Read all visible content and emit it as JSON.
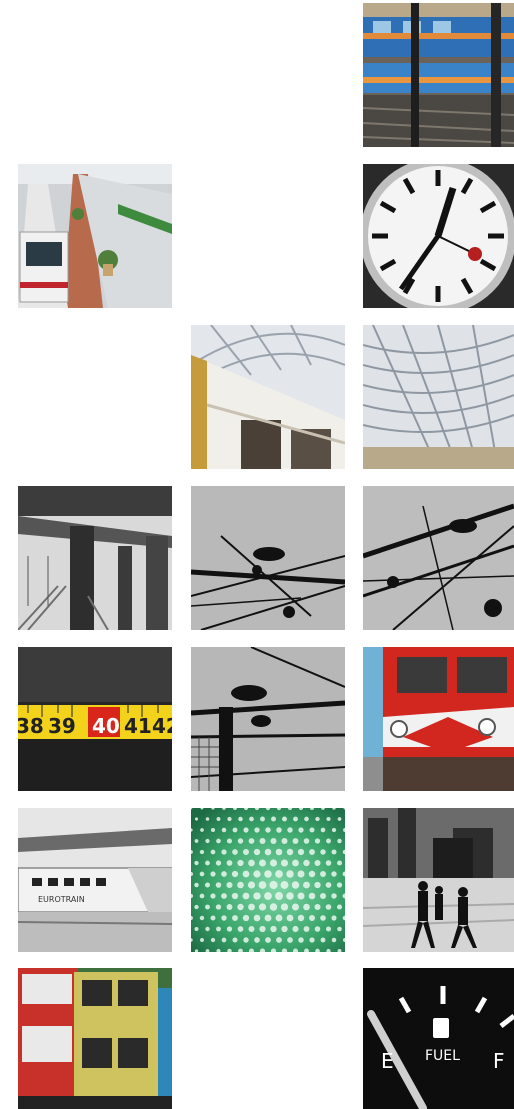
{
  "gallery": {
    "tiles": [
      {
        "subject": "blue-train-reflection"
      },
      {
        "subject": "trains-at-platform"
      },
      {
        "subject": "station-clock"
      },
      {
        "subject": "train-glass-canopy"
      },
      {
        "subject": "glass-canopy-arches"
      },
      {
        "subject": "elevated-railway-bw"
      },
      {
        "subject": "overhead-wires-1"
      },
      {
        "subject": "overhead-wires-2"
      },
      {
        "subject": "tape-measure"
      },
      {
        "subject": "overhead-wires-pole"
      },
      {
        "subject": "red-locomotive"
      },
      {
        "subject": "bw-train-station"
      },
      {
        "subject": "green-pattern"
      },
      {
        "subject": "pedestrians-crossing"
      },
      {
        "subject": "vintage-buses"
      },
      {
        "subject": "fuel-gauge"
      }
    ],
    "tape_numbers": [
      "38",
      "39",
      "40",
      "41",
      "42"
    ],
    "train_text": "EUROTRAIN",
    "gauge": {
      "empty_label": "E",
      "full_label": "F",
      "center_label": "FUEL"
    }
  },
  "colors": {
    "tape_yellow": "#f2d21a",
    "tape_red": "#d8261b",
    "loco_red": "#d1271f",
    "green": "#3aa56a",
    "background": "#ffffff"
  }
}
